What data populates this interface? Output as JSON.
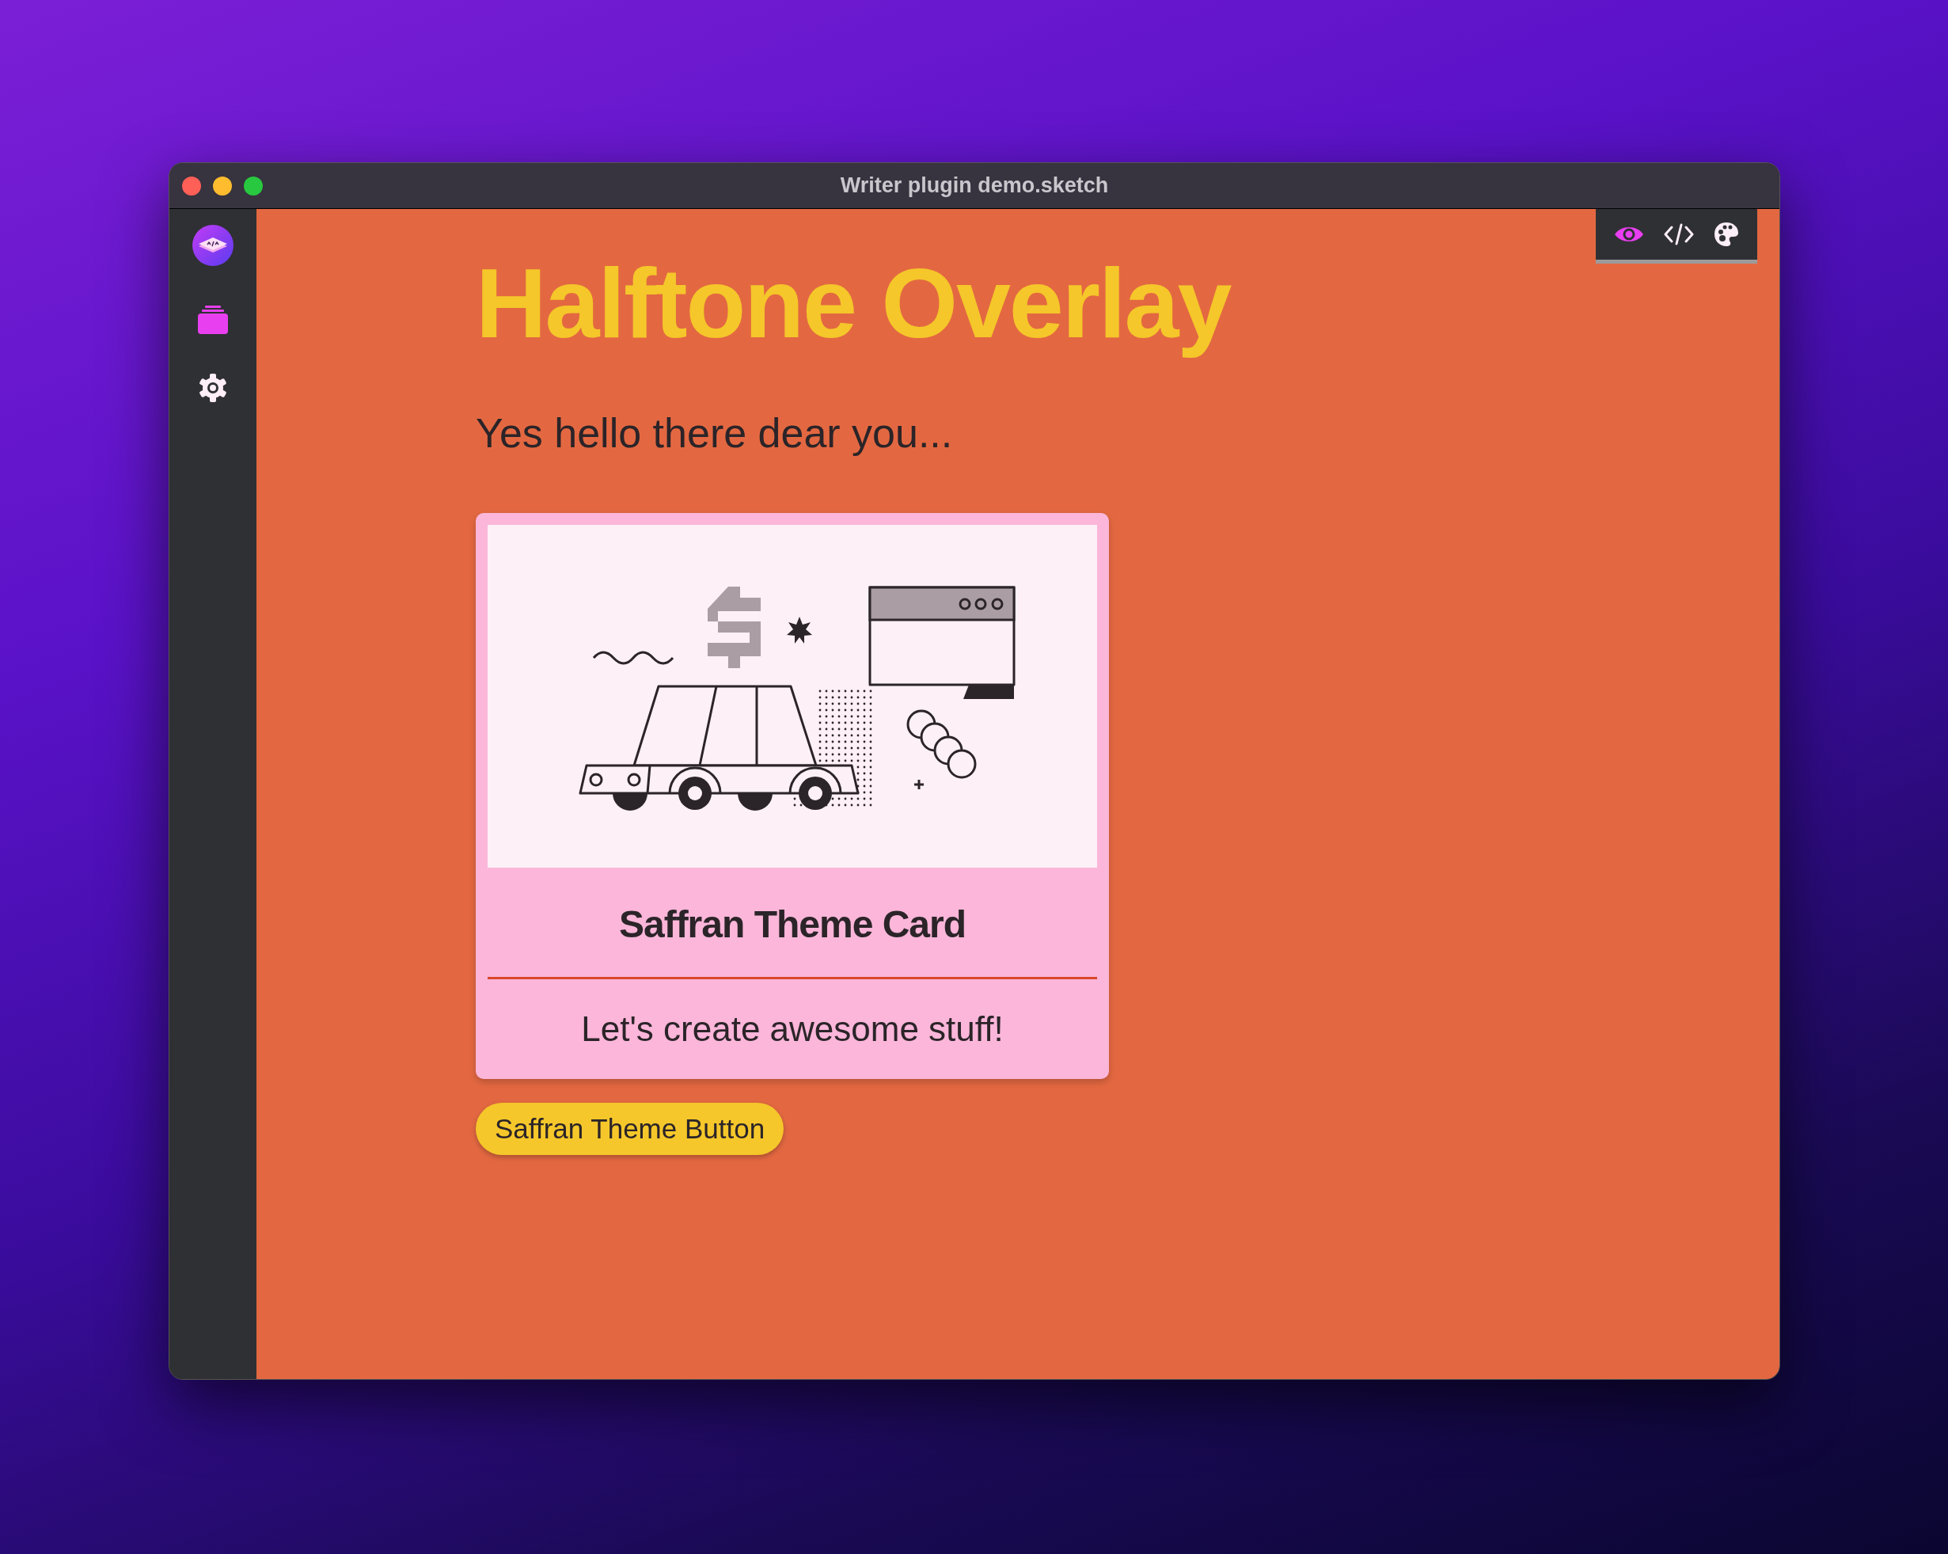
{
  "window": {
    "title": "Writer plugin demo.sketch"
  },
  "sidebar": {
    "items": [
      {
        "kind": "logo"
      },
      {
        "kind": "stack",
        "selected": true
      },
      {
        "kind": "settings",
        "selected": false
      }
    ]
  },
  "toolbar": [
    {
      "kind": "preview",
      "selected": true
    },
    {
      "kind": "code",
      "selected": false
    },
    {
      "kind": "palette",
      "selected": false
    }
  ],
  "content": {
    "heading": "Halftone Overlay",
    "subtitle": "Yes hello there dear you...",
    "card": {
      "title": "Saffran Theme Card",
      "text": "Let's create awesome stuff!"
    },
    "button": "Saffran Theme Button"
  }
}
